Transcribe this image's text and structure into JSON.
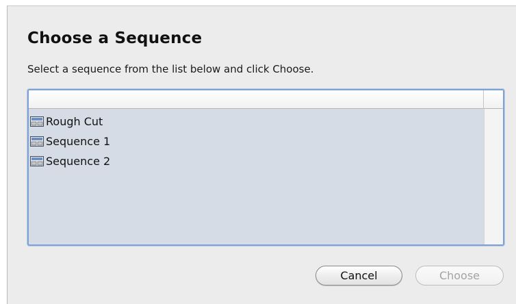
{
  "dialog": {
    "title": "Choose a Sequence",
    "instructions": "Select a sequence from the list below and click Choose."
  },
  "sequence_list": {
    "items": [
      {
        "label": "Rough Cut",
        "icon": "sequence-icon"
      },
      {
        "label": "Sequence 1",
        "icon": "sequence-icon"
      },
      {
        "label": "Sequence 2",
        "icon": "sequence-icon"
      }
    ]
  },
  "buttons": {
    "cancel_label": "Cancel",
    "choose_label": "Choose",
    "choose_enabled": false
  },
  "colors": {
    "list_background": "#d6dce5",
    "focus_ring": "#7ea3d3",
    "dialog_background": "#ececec"
  }
}
